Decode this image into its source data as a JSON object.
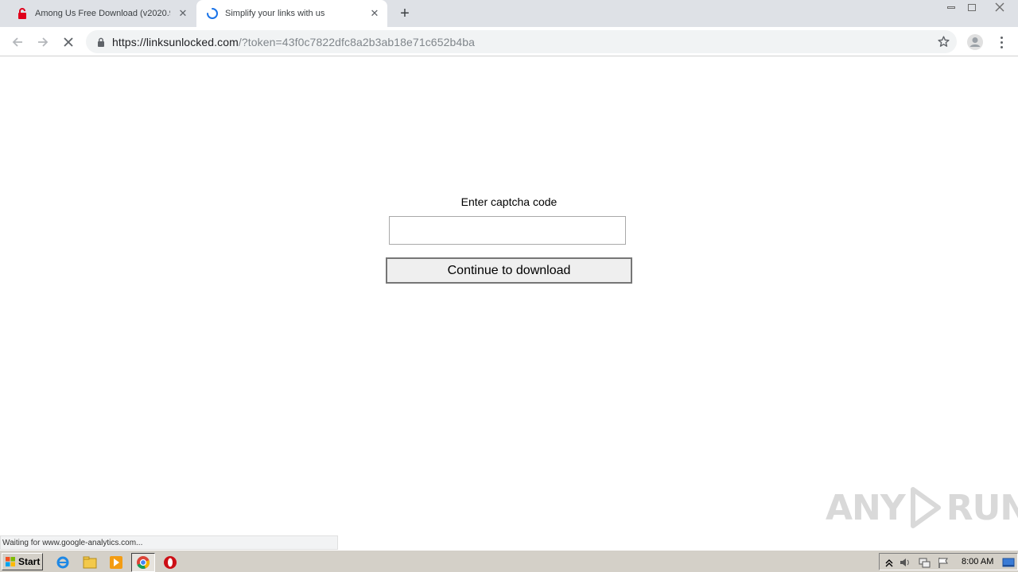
{
  "browser": {
    "tabs": [
      {
        "title": "Among Us Free Download (v2020.9",
        "icon": "red-lock-favicon-icon",
        "active": false
      },
      {
        "title": "Simplify your links with us",
        "icon": "loading-spinner-icon",
        "active": true
      }
    ],
    "url_host": "https://linksunlocked.com",
    "url_rest": "/?token=43f0c7822dfc8a2b3ab18e71c652b4ba"
  },
  "page": {
    "captcha_label": "Enter captcha code",
    "captcha_value": "",
    "continue_label": "Continue to download",
    "status_text": "Waiting for www.google-analytics.com...",
    "watermark": {
      "left": "ANY",
      "right": "RUN"
    }
  },
  "taskbar": {
    "start_label": "Start",
    "clock": "8:00 AM"
  },
  "colors": {
    "tab_strip": "#dee1e6",
    "omnibox": "#f1f3f4",
    "taskbar": "#d4d0c8"
  }
}
